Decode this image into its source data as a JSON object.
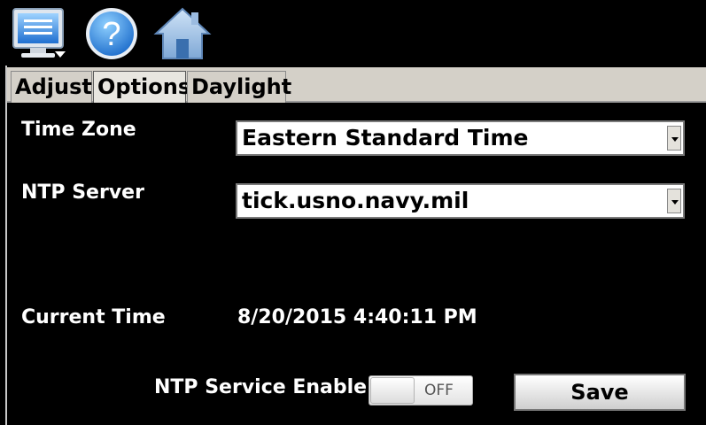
{
  "toolbar": {
    "icons": [
      "monitor-menu-icon",
      "help-icon",
      "home-icon"
    ],
    "help_glyph": "?"
  },
  "tabs": [
    {
      "label": "Adjust",
      "active": false
    },
    {
      "label": "Options",
      "active": true
    },
    {
      "label": "Daylight",
      "active": false
    }
  ],
  "options": {
    "time_zone": {
      "label": "Time Zone",
      "value": "Eastern Standard Time"
    },
    "ntp_server": {
      "label": "NTP Server",
      "value": "tick.usno.navy.mil"
    },
    "current_time": {
      "label": "Current Time",
      "value": "8/20/2015 4:40:11 PM"
    },
    "ntp_service": {
      "label": "NTP Service Enable",
      "state": "OFF"
    },
    "save_label": "Save"
  },
  "colors": {
    "background": "#000000",
    "tab_bar": "#d4d0c8",
    "text": "#ffffff",
    "icon_blue": "#2a7fd8"
  }
}
